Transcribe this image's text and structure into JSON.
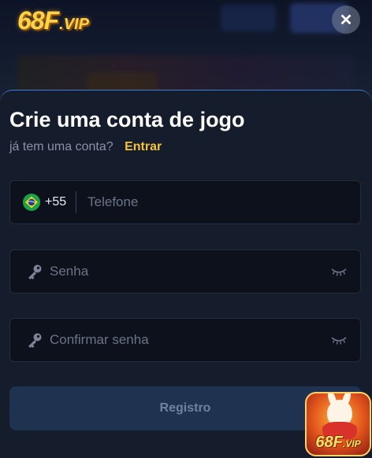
{
  "brand": {
    "logo_main": "68F",
    "logo_suffix": ".VIP"
  },
  "header": {
    "close_label": "✕"
  },
  "form": {
    "title": "Crie uma conta de jogo",
    "have_account_text": "já tem uma conta?",
    "login_link": "Entrar",
    "phone": {
      "country_code": "+55",
      "placeholder": "Telefone",
      "flag": "brazil-flag-icon"
    },
    "password": {
      "placeholder": "Senha",
      "icon": "key-icon",
      "toggle_icon": "eye-closed-icon"
    },
    "confirm_password": {
      "placeholder": "Confirmar senha",
      "icon": "key-icon",
      "toggle_icon": "eye-closed-icon"
    },
    "submit_label": "Registro"
  },
  "promo_badge": {
    "text_main": "68F",
    "text_suffix": ".VIP"
  },
  "colors": {
    "accent_link": "#f4c23f",
    "sheet_bg": "#151c2c",
    "field_bg": "#0c111c",
    "button_bg": "#1f3250",
    "sheet_border": "#3c7fd6"
  }
}
